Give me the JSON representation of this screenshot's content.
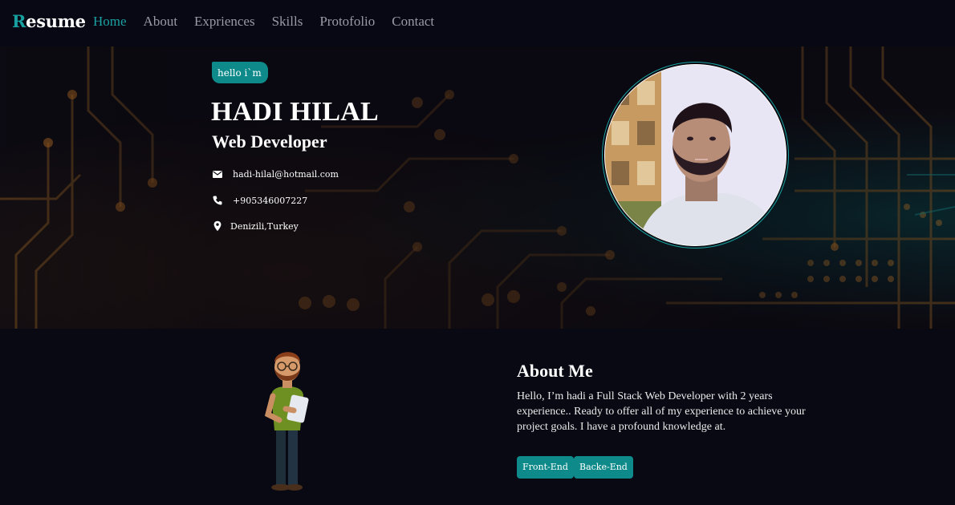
{
  "brand": {
    "first_letter": "R",
    "rest": "esume"
  },
  "nav": [
    {
      "label": "Home",
      "active": true
    },
    {
      "label": "About",
      "active": false
    },
    {
      "label": "Expriences",
      "active": false
    },
    {
      "label": "Skills",
      "active": false
    },
    {
      "label": "Protofolio",
      "active": false
    },
    {
      "label": "Contact",
      "active": false
    }
  ],
  "hero": {
    "greeting": "hello i`m",
    "name": "HADI HILAL",
    "role": "Web Developer",
    "contacts": {
      "email": {
        "icon": "envelope-icon",
        "value": "hadi-hilal@hotmail.com"
      },
      "phone": {
        "icon": "phone-icon",
        "value": "+905346007227"
      },
      "location": {
        "icon": "map-marker-icon",
        "value": "Denizili,Turkey"
      }
    }
  },
  "about": {
    "title": "About Me",
    "text": "Hello, I’m hadi a Full Stack Web Developer with 2 years experience.. Ready to offer all of my experience to achieve your project goals. I have a profound knowledge at.",
    "tags": [
      "Front-End",
      "Backe-End"
    ]
  },
  "colors": {
    "accent": "#0e8a8a",
    "background": "#090914",
    "nav_active": "#1ba2a2"
  }
}
